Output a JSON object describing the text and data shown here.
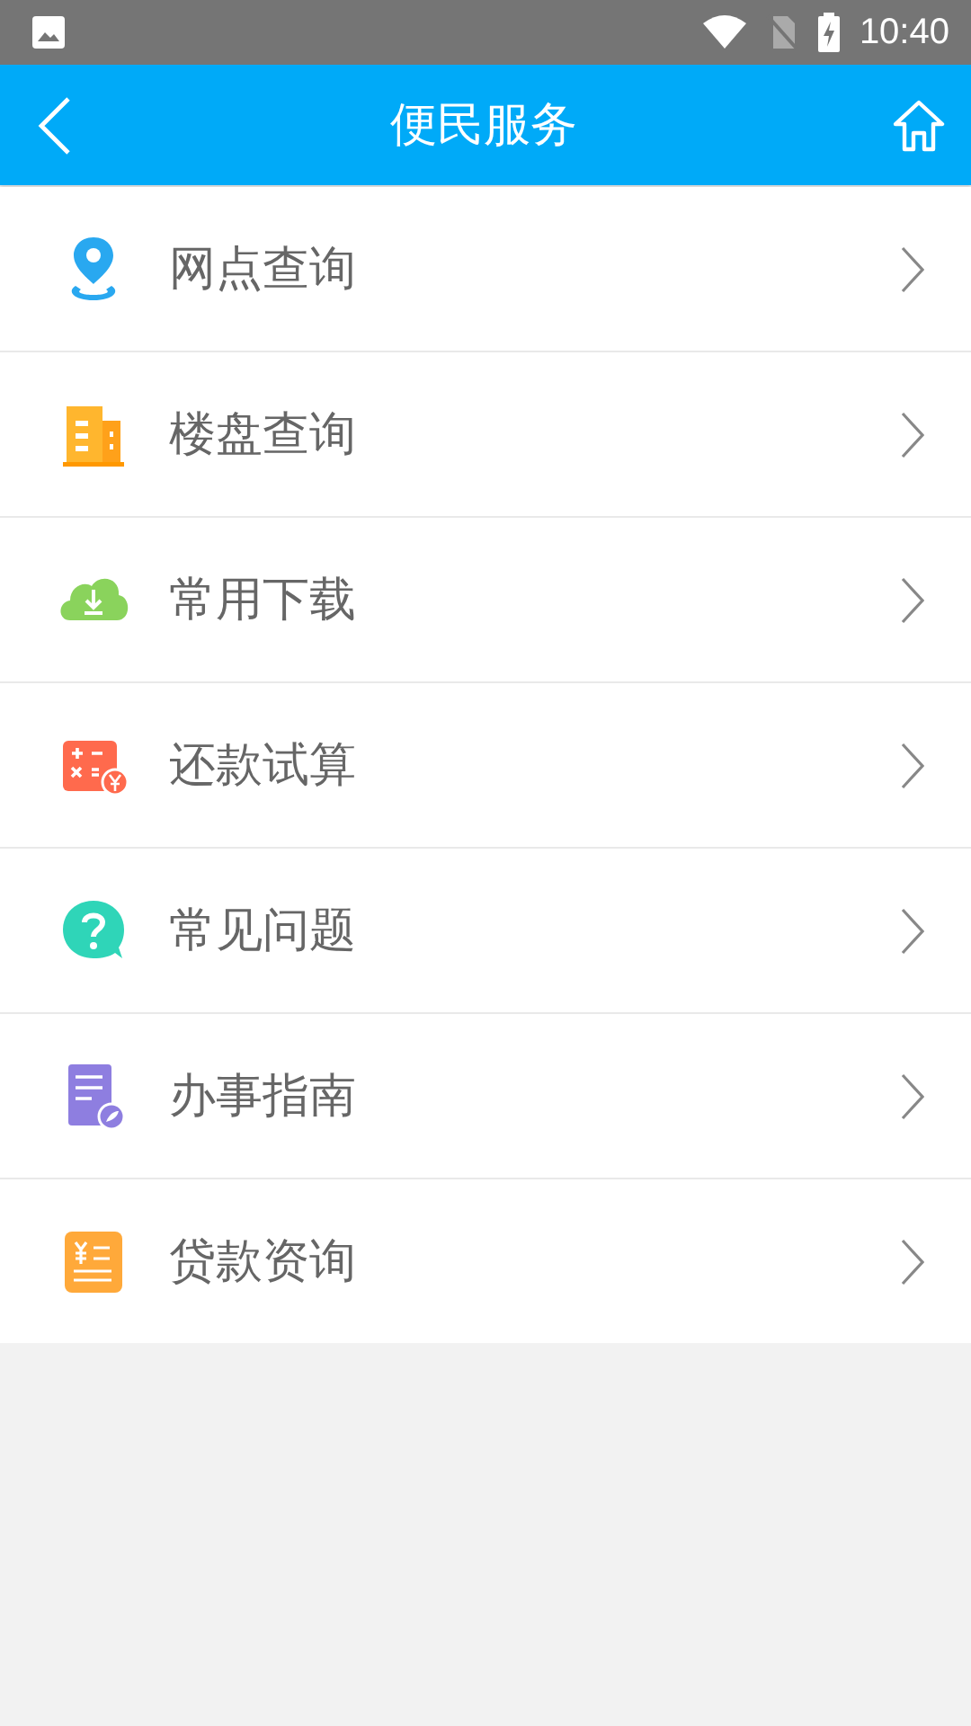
{
  "status_bar": {
    "time": "10:40"
  },
  "header": {
    "title": "便民服务"
  },
  "items": [
    {
      "label": "网点查询",
      "kind": "location"
    },
    {
      "label": "楼盘查询",
      "kind": "building"
    },
    {
      "label": "常用下载",
      "kind": "download"
    },
    {
      "label": "还款试算",
      "kind": "calculator"
    },
    {
      "label": "常见问题",
      "kind": "question"
    },
    {
      "label": "办事指南",
      "kind": "guide"
    },
    {
      "label": "贷款资询",
      "kind": "loan"
    }
  ]
}
